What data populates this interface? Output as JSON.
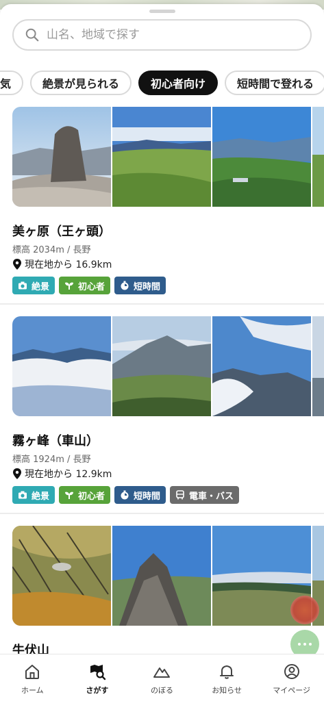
{
  "search": {
    "placeholder": "山名、地域で探す"
  },
  "chips": [
    {
      "label": "気"
    },
    {
      "label": "絶景が見られる"
    },
    {
      "label": "初心者向け"
    },
    {
      "label": "短時間で登れる"
    }
  ],
  "cards": [
    {
      "name": "美ヶ原（王ヶ頭）",
      "elevation": "標高 2034m / 長野",
      "distance": "現在地から 16.9km",
      "tags": [
        "絶景",
        "初心者",
        "短時間"
      ]
    },
    {
      "name": "霧ヶ峰（車山）",
      "elevation": "標高 1924m / 長野",
      "distance": "現在地から 12.9km",
      "tags": [
        "絶景",
        "初心者",
        "短時間",
        "電車・バス"
      ]
    },
    {
      "name": "牛伏山"
    }
  ],
  "tabbar": [
    {
      "label": "ホーム",
      "icon": "home-icon"
    },
    {
      "label": "さがす",
      "icon": "map-search-icon"
    },
    {
      "label": "のぼる",
      "icon": "mountain-icon"
    },
    {
      "label": "お知らせ",
      "icon": "bell-icon"
    },
    {
      "label": "マイページ",
      "icon": "user-icon"
    }
  ],
  "colors": {
    "tag_zekkei": "#2faab3",
    "tag_beginner": "#57a33a",
    "tag_short": "#2f5c8c",
    "tag_train": "#6b6b6b",
    "chip_active": "#111111"
  }
}
